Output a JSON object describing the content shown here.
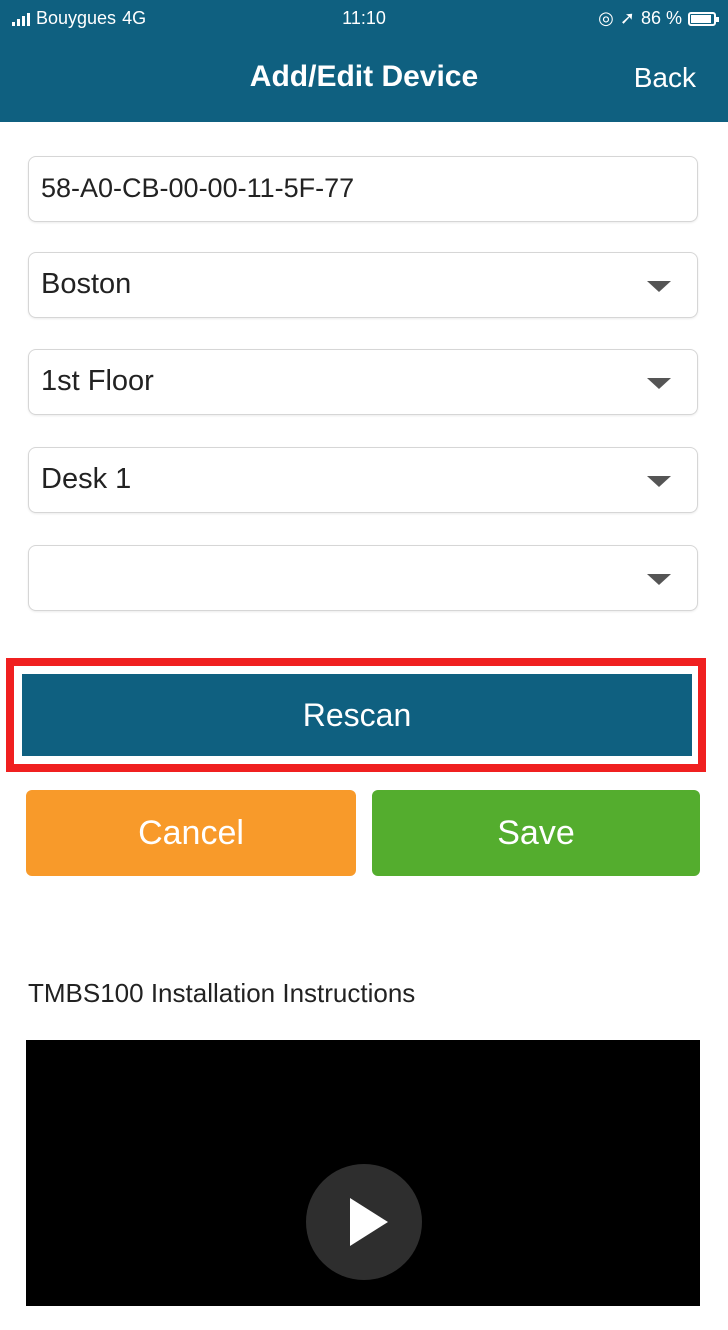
{
  "status_bar": {
    "carrier": "Bouygues",
    "network": "4G",
    "time": "11:10",
    "location_glyph": "◎",
    "arrow_glyph": "➚",
    "battery_percent": "86 %",
    "signal_icon": "signal-icon",
    "battery_icon": "battery-icon"
  },
  "header": {
    "title": "Add/Edit Device",
    "back_label": "Back",
    "background_color": "#0f6080"
  },
  "form": {
    "device_id": {
      "value": "58-A0-CB-00-00-11-5F-77"
    },
    "city_select": {
      "selected": "Boston"
    },
    "floor_select": {
      "selected": "1st Floor"
    },
    "desk_select": {
      "selected": "Desk 1"
    },
    "extra_select": {
      "selected": ""
    }
  },
  "buttons": {
    "rescan_label": "Rescan",
    "cancel_label": "Cancel",
    "save_label": "Save",
    "rescan_color": "#0f6080",
    "cancel_color": "#f89a2a",
    "save_color": "#54ad2e",
    "highlight_color": "#f02020"
  },
  "instructions": {
    "label": "TMBS100 Installation Instructions"
  },
  "video": {
    "play_icon": "play-icon"
  }
}
